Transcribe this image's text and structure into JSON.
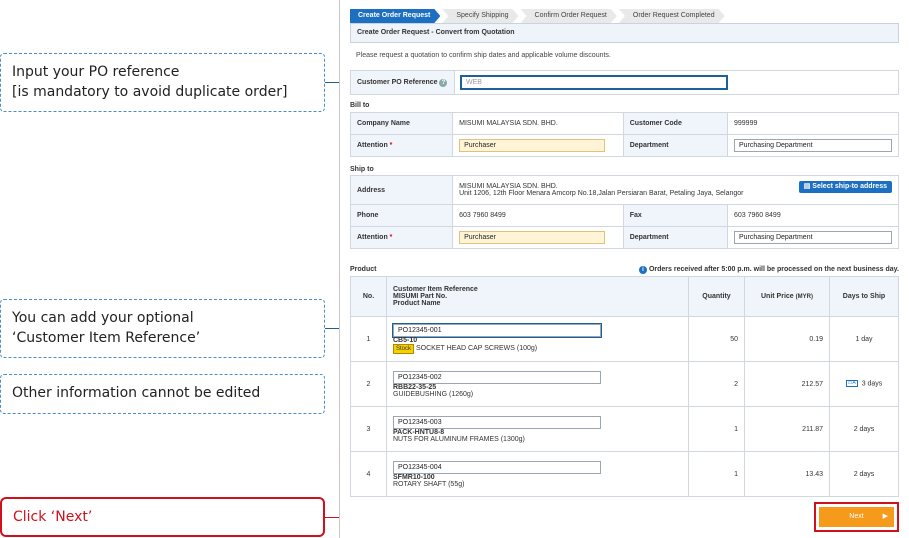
{
  "callouts": {
    "po": "Input your PO reference\n[is mandatory to avoid duplicate order]",
    "po_line1": "Input your PO reference",
    "po_line2": "[is mandatory to avoid duplicate order]",
    "cust_line1": "You can add your optional",
    "cust_line2": "‘Customer Item Reference’",
    "other": "Other information cannot be edited",
    "next": "Click ‘Next’"
  },
  "steps": [
    "Create Order Request",
    "Specify Shipping",
    "Confirm Order Request",
    "Order Request Completed"
  ],
  "header": "Create Order Request - Convert from Quotation",
  "note": "Please request a quotation to confirm ship dates and applicable volume discounts.",
  "po_ref": {
    "label": "Customer PO Reference",
    "value": "WEB"
  },
  "bill_to": {
    "title": "Bill to",
    "company_label": "Company Name",
    "company": "MISUMI MALAYSIA SDN. BHD.",
    "code_label": "Customer Code",
    "code": "999999",
    "attention_label": "Attention",
    "attention": "Purchaser",
    "dept_label": "Department",
    "dept": "Purchasing Department"
  },
  "ship_to": {
    "title": "Ship to",
    "address_label": "Address",
    "address1": "MISUMI MALAYSIA SDN. BHD.",
    "address2": "Unit 1206, 12th Floor Menara Amcorp No.18,Jalan Persiaran Barat, Petaling Jaya, Selangor",
    "select_button": "Select ship-to address",
    "phone_label": "Phone",
    "phone": "603 7960 8499",
    "fax_label": "Fax",
    "fax": "603 7960 8499",
    "attention_label": "Attention",
    "attention": "Purchaser",
    "dept_label": "Department",
    "dept": "Purchasing Department"
  },
  "product": {
    "title": "Product",
    "notice": "Orders received after 5:00 p.m. will be processed on the next business day.",
    "headers": {
      "no": "No.",
      "ref1": "Customer Item Reference",
      "ref2": "MISUMI Part No.",
      "ref3": "Product Name",
      "qty": "Quantity",
      "price": "Unit Price",
      "price_unit": "(MYR)",
      "days": "Days to Ship"
    },
    "rows": [
      {
        "no": "1",
        "ref": "PO12345-001",
        "part": "CB5-10",
        "stock": "Stock",
        "name": "SOCKET HEAD CAP SCREWS (100g)",
        "qty": "50",
        "price": "0.19",
        "days": "1 day"
      },
      {
        "no": "2",
        "ref": "PO12345-002",
        "part": "RBB22-35-25",
        "name": "GUIDEBUSHING (1260g)",
        "qty": "2",
        "price": "212.57",
        "days": "3 days"
      },
      {
        "no": "3",
        "ref": "PO12345-003",
        "part": "PACK-HNTU8-8",
        "name": "NUTS FOR ALUMINUM FRAMES (1300g)",
        "qty": "1",
        "price": "211.87",
        "days": "2 days"
      },
      {
        "no": "4",
        "ref": "PO12345-004",
        "part": "SFMR10-100",
        "name": "ROTARY SHAFT (55g)",
        "qty": "1",
        "price": "13.43",
        "days": "2 days"
      }
    ]
  },
  "next_button": "Next",
  "colors": {
    "accent": "#1d6fc1",
    "next": "#f59a1b",
    "callout_red": "#d0101a"
  }
}
